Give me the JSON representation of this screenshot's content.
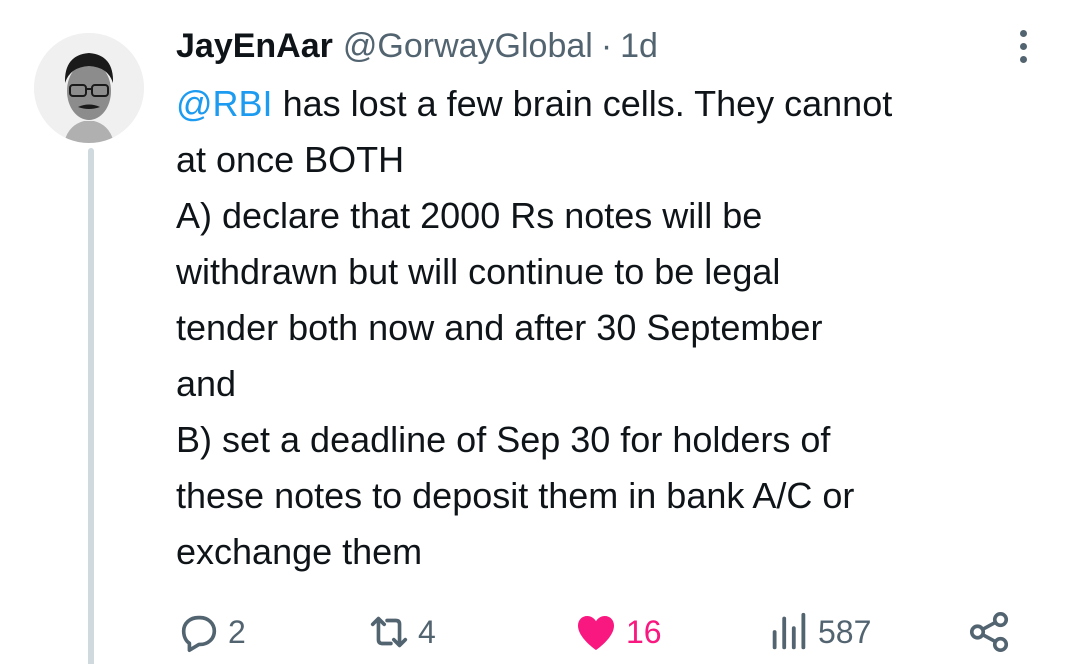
{
  "tweet": {
    "display_name": "JayEnAar",
    "handle": "@GorwayGlobal",
    "separator": "·",
    "time": "1d",
    "mention": "@RBI",
    "lines": [
      " has lost a few brain cells. They cannot",
      "at once  BOTH",
      "A) declare that 2000 Rs notes will be",
      "withdrawn but will continue to be legal",
      "tender both now and after 30 September",
      "and",
      "B) set a deadline of Sep 30 for holders of",
      "these notes to deposit them in bank A/C or",
      "exchange them"
    ]
  },
  "actions": {
    "replies": "2",
    "retweets": "4",
    "likes": "16",
    "views": "587"
  },
  "icons": {
    "reply": "reply-icon",
    "retweet": "retweet-icon",
    "like": "heart-icon",
    "views": "views-icon",
    "share": "share-icon",
    "more": "more-icon"
  },
  "colors": {
    "accent": "#1d9bf0",
    "like": "#f91880",
    "muted": "#536471",
    "text": "#0f1419",
    "thread_line": "#cfd9de"
  }
}
